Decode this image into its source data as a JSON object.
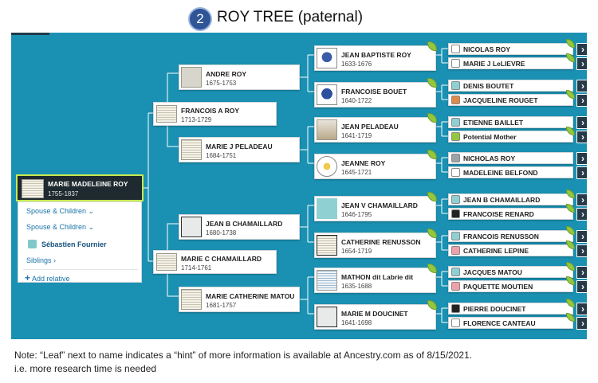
{
  "header": {
    "number": "2",
    "title": "ROY TREE (paternal)"
  },
  "root": {
    "name": "MARIE MADELEINE ROY",
    "dates": "1755-1837",
    "links": {
      "spouse_children_1": "Spouse & Children",
      "spouse_children_2": "Spouse & Children",
      "spouse_name": "Sébastien Fournier",
      "siblings": "Siblings",
      "add_relative": "Add relative"
    }
  },
  "gen1": [
    {
      "name": "FRANCOIS A ROY",
      "dates": "1713-1729"
    },
    {
      "name": "MARIE C CHAMAILLARD",
      "dates": "1714-1761"
    }
  ],
  "gen2": [
    {
      "name": "ANDRE ROY",
      "dates": "1675-1753"
    },
    {
      "name": "MARIE J PELADEAU",
      "dates": "1684-1751"
    },
    {
      "name": "JEAN B CHAMAILLARD",
      "dates": "1680-1738"
    },
    {
      "name": "MARIE CATHERINE MATOU",
      "dates": "1681-1757"
    }
  ],
  "gen3": [
    {
      "name": "JEAN BAPTISTE ROY",
      "dates": "1633-1676"
    },
    {
      "name": "FRANCOISE BOUET",
      "dates": "1640-1722"
    },
    {
      "name": "JEAN PELADEAU",
      "dates": "1641-1719"
    },
    {
      "name": "JEANNE ROY",
      "dates": "1645-1721"
    },
    {
      "name": "JEAN V CHAMAILLARD",
      "dates": "1646-1795"
    },
    {
      "name": "CATHERINE RENUSSON",
      "dates": "1654-1719"
    },
    {
      "name": "MATHON dit Labrie dit",
      "dates": "1635-1688"
    },
    {
      "name": "MARIE M DOUCINET",
      "dates": "1641-1698"
    }
  ],
  "gen4": [
    {
      "name": "NICOLAS ROY"
    },
    {
      "name": "MARIE J LeLIEVRE"
    },
    {
      "name": "DENIS BOUTET"
    },
    {
      "name": "JACQUELINE ROUGET"
    },
    {
      "name": "ETIENNE BAILLET"
    },
    {
      "name": "Potential Mother"
    },
    {
      "name": "NICHOLAS ROY"
    },
    {
      "name": "MADELEINE BELFOND"
    },
    {
      "name": "JEAN B CHAMAILLARD"
    },
    {
      "name": "FRANCOISE RENARD"
    },
    {
      "name": "FRANCOIS RENUSSON"
    },
    {
      "name": "CATHERINE LEPINE"
    },
    {
      "name": "JACQUES MATOU"
    },
    {
      "name": "PAQUETTE MOUTIEN"
    },
    {
      "name": "PIERRE DOUCINET"
    },
    {
      "name": "FLORENCE CANTEAU"
    }
  ],
  "chevron": "›",
  "note": {
    "line1": "Note: “Leaf” next to name indicates a “hint” of more information is available at Ancestry.com as of 8/15/2021.",
    "line2": "i.e. more research time is needed"
  }
}
